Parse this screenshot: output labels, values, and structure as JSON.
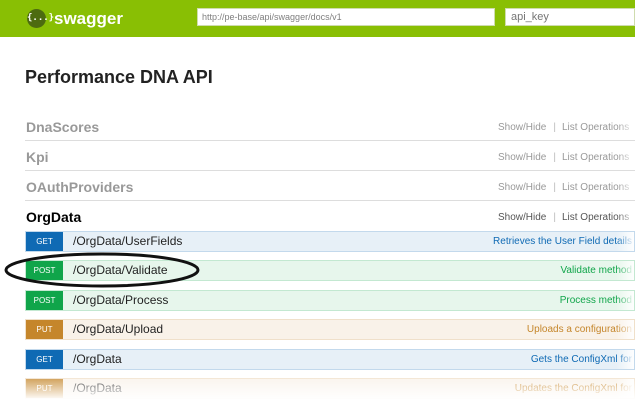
{
  "header": {
    "logo_glyph": "{...}",
    "logo_text": "swagger",
    "url_value": "http://pe-base/api/swagger/docs/v1",
    "api_key_placeholder": "api_key",
    "bg_color": "#89bf04"
  },
  "page_title": "Performance DNA API",
  "resources": [
    {
      "name": "DnaScores",
      "show_hide": "Show/Hide",
      "list_ops": "List Operations"
    },
    {
      "name": "Kpi",
      "show_hide": "Show/Hide",
      "list_ops": "List Operations"
    },
    {
      "name": "OAuthProviders",
      "show_hide": "Show/Hide",
      "list_ops": "List Operations"
    },
    {
      "name": "OrgData",
      "show_hide": "Show/Hide",
      "list_ops": "List Operations"
    }
  ],
  "operations": [
    {
      "method": "GET",
      "path": "/OrgData/UserFields",
      "desc": "Retrieves the User Field details"
    },
    {
      "method": "POST",
      "path": "/OrgData/Validate",
      "desc": "Validate method"
    },
    {
      "method": "POST",
      "path": "/OrgData/Process",
      "desc": "Process method"
    },
    {
      "method": "PUT",
      "path": "/OrgData/Upload",
      "desc": "Uploads a configuration"
    },
    {
      "method": "GET",
      "path": "/OrgData",
      "desc": "Gets the ConfigXml for"
    },
    {
      "method": "PUT",
      "path": "/OrgData",
      "desc": "Updates the ConfigXml for"
    }
  ],
  "colors": {
    "get": "#0f6ab4",
    "post": "#10a54a",
    "put": "#c5862b"
  }
}
